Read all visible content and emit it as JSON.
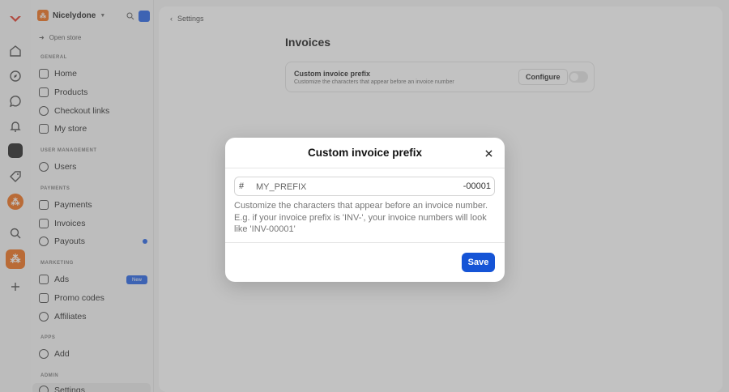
{
  "colors": {
    "accent": "#1554d6",
    "brand": "#ef6a10",
    "overlay": "#6e6e6e"
  },
  "rail": {
    "icons": [
      "brand-logo-icon",
      "home-icon",
      "compass-icon",
      "chat-icon",
      "bell-icon",
      "app-square-icon",
      "tag-icon",
      "app-circle-icon",
      "search-icon",
      "workspace-icon",
      "plus-icon"
    ]
  },
  "sidebar": {
    "workspace_name": "Nicelydone",
    "open_store": "Open store",
    "sections": {
      "general": "GENERAL",
      "user_management": "USER MANAGEMENT",
      "payments": "PAYMENTS",
      "marketing": "MARKETING",
      "apps": "APPS",
      "admin": "ADMIN"
    },
    "items": {
      "home": "Home",
      "products": "Products",
      "checkout_links": "Checkout links",
      "my_store": "My store",
      "users": "Users",
      "payments": "Payments",
      "invoices": "Invoices",
      "payouts": "Payouts",
      "ads": "Ads",
      "ads_badge": "New",
      "promo_codes": "Promo codes",
      "affiliates": "Affiliates",
      "add": "Add",
      "settings": "Settings"
    }
  },
  "main": {
    "breadcrumb": "Settings",
    "page_title": "Invoices",
    "card": {
      "title": "Custom invoice prefix",
      "subtitle": "Customize the characters that appear before an invoice number",
      "configure_label": "Configure",
      "toggle_on": false
    }
  },
  "modal": {
    "title": "Custom invoice prefix",
    "prefix_symbol": "#",
    "input_placeholder": "MY_PREFIX",
    "input_value": "",
    "suffix": "-00001",
    "help_text": "Customize the characters that appear before an invoice number. E.g. if your invoice prefix is 'INV-', your invoice numbers will look like 'INV-00001'",
    "save_label": "Save"
  }
}
